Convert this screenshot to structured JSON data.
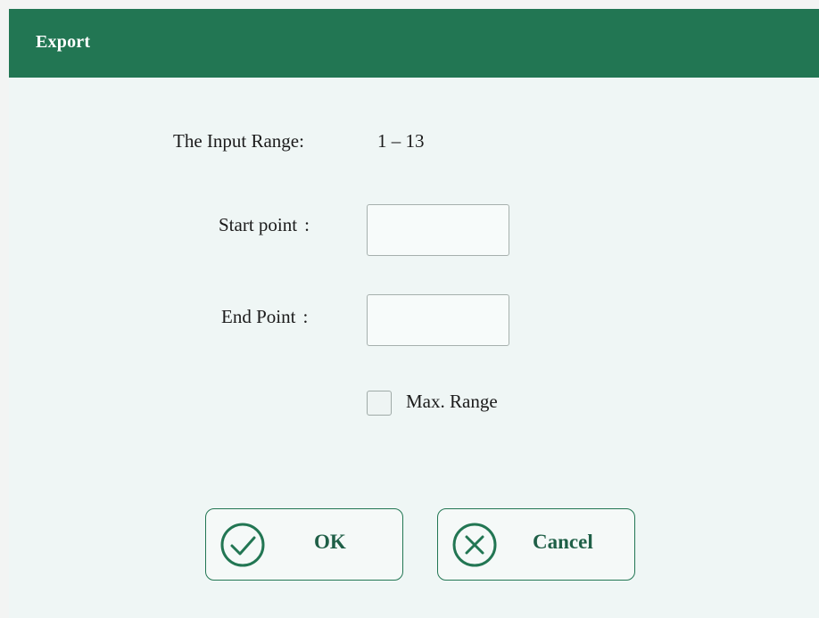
{
  "dialog": {
    "title": "Export",
    "range_label": "The Input Range:",
    "range_value": "1 – 13",
    "start_label": "Start point",
    "end_label": "End Point",
    "colon": ":",
    "start_value": "",
    "end_value": "",
    "max_range_label": "Max. Range",
    "max_range_checked": false,
    "ok_label": "OK",
    "cancel_label": "Cancel"
  },
  "icons": {
    "ok": "check-circle-icon",
    "cancel": "x-circle-icon"
  },
  "colors": {
    "titlebar": "#227653",
    "background": "#eff6f5",
    "accent": "#227653"
  }
}
